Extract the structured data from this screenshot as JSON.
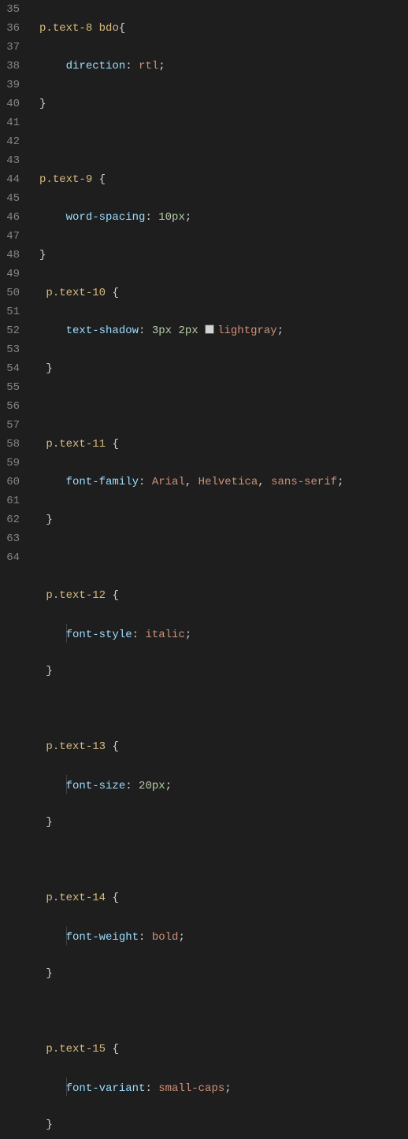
{
  "line_numbers": [
    "35",
    "36",
    "37",
    "38",
    "39",
    "40",
    "41",
    "42",
    "43",
    "44",
    "45",
    "46",
    "47",
    "48",
    "49",
    "50",
    "51",
    "52",
    "53",
    "54",
    "55",
    "56",
    "57",
    "58",
    "59",
    "60",
    "61",
    "62",
    "63",
    "64"
  ],
  "tokens": {
    "p": "p",
    "dot": ".",
    "text8": "text-8",
    "bdo": " bdo",
    "text9": "text-9",
    "text10": "text-10",
    "text11": "text-11",
    "text12": "text-12",
    "text13": "text-13",
    "text14": "text-14",
    "text15": "text-15",
    "ob": "{",
    "cb": "}",
    "colon": ": ",
    "semi": ";",
    "comma": ", ",
    "direction": "direction",
    "rtl": "rtl",
    "wordspacing": "word-spacing",
    "tenpx": "10px",
    "textshadow": "text-shadow",
    "threepx": "3px",
    "twopx": "2px",
    "lightgray": "lightgray",
    "fontfamily": "font-family",
    "arial": "Arial",
    "helvetica": "Helvetica",
    "sans": "sans-serif",
    "fontstyle": "font-style",
    "italic": "italic",
    "fontsize": "font-size",
    "twentypx": "20px",
    "fontweight": "font-weight",
    "bold": "bold",
    "fontvariant": "font-variant",
    "smallcaps": "small-caps"
  },
  "colors": {
    "swatch": "#d3d3d3"
  },
  "chart_data": {
    "type": "table",
    "title": "CSS rules",
    "rows": [
      {
        "selector": "p.text-8 bdo",
        "property": "direction",
        "value": "rtl"
      },
      {
        "selector": "p.text-9",
        "property": "word-spacing",
        "value": "10px"
      },
      {
        "selector": "p.text-10",
        "property": "text-shadow",
        "value": "3px 2px lightgray"
      },
      {
        "selector": "p.text-11",
        "property": "font-family",
        "value": "Arial, Helvetica, sans-serif"
      },
      {
        "selector": "p.text-12",
        "property": "font-style",
        "value": "italic"
      },
      {
        "selector": "p.text-13",
        "property": "font-size",
        "value": "20px"
      },
      {
        "selector": "p.text-14",
        "property": "font-weight",
        "value": "bold"
      },
      {
        "selector": "p.text-15",
        "property": "font-variant",
        "value": "small-caps"
      }
    ]
  }
}
